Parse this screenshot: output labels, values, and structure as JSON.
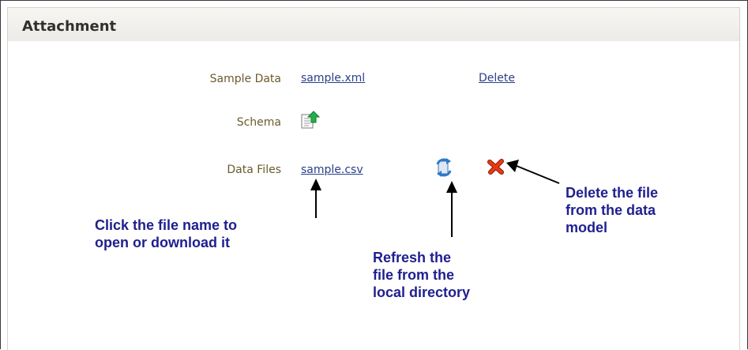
{
  "panel": {
    "title": "Attachment"
  },
  "rows": {
    "sample_data": {
      "label": "Sample Data",
      "file_link": "sample.xml",
      "delete_link": "Delete"
    },
    "schema": {
      "label": "Schema",
      "icon": "upload-schema-icon"
    },
    "data_files": {
      "label": "Data Files",
      "file_link": "sample.csv",
      "refresh_icon": "refresh-icon",
      "delete_icon": "red-x-delete-icon"
    }
  },
  "callouts": {
    "file_name": "Click the file name to\nopen or download it",
    "refresh": "Refresh the\nfile from the\nlocal directory",
    "delete": "Delete the file\nfrom the data\nmodel"
  },
  "colors": {
    "label": "#6b5a2e",
    "link": "#29408a",
    "callout": "#1f1f8f",
    "delete_icon": "#e02f10"
  }
}
